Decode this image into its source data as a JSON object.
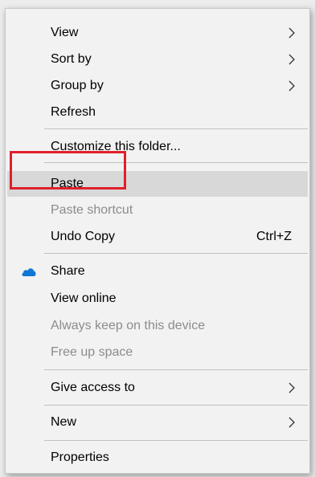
{
  "menu": {
    "items": [
      {
        "label": "View",
        "submenu": true,
        "disabled": false
      },
      {
        "label": "Sort by",
        "submenu": true,
        "disabled": false
      },
      {
        "label": "Group by",
        "submenu": true,
        "disabled": false
      },
      {
        "label": "Refresh",
        "submenu": false,
        "disabled": false
      },
      {
        "label": "Customize this folder...",
        "submenu": false,
        "disabled": false
      },
      {
        "label": "Paste",
        "submenu": false,
        "disabled": false,
        "highlighted": true
      },
      {
        "label": "Paste shortcut",
        "submenu": false,
        "disabled": true
      },
      {
        "label": "Undo Copy",
        "shortcut": "Ctrl+Z",
        "submenu": false,
        "disabled": false
      },
      {
        "label": "Share",
        "icon": "onedrive-cloud-icon",
        "submenu": false,
        "disabled": false
      },
      {
        "label": "View online",
        "submenu": false,
        "disabled": false
      },
      {
        "label": "Always keep on this device",
        "submenu": false,
        "disabled": true
      },
      {
        "label": "Free up space",
        "submenu": false,
        "disabled": true
      },
      {
        "label": "Give access to",
        "submenu": true,
        "disabled": false
      },
      {
        "label": "New",
        "submenu": true,
        "disabled": false
      },
      {
        "label": "Properties",
        "submenu": false,
        "disabled": false
      }
    ]
  },
  "colors": {
    "menu_background": "#f2f2f2",
    "hover_background": "#d8d8d8",
    "disabled_text": "#8c8c8c",
    "highlight_box": "#e0202a",
    "onedrive_icon": "#0f78d4"
  }
}
